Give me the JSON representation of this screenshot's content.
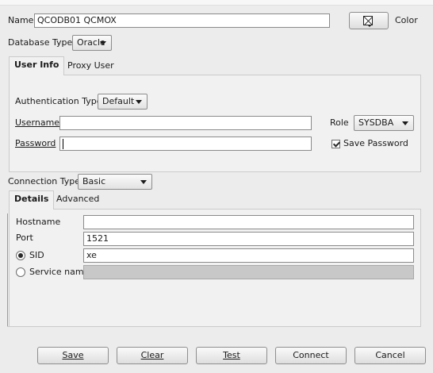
{
  "name": {
    "label": "Name",
    "value": "QCODB01 QCMOX"
  },
  "color": {
    "label": "Color"
  },
  "database_type": {
    "label": "Database Type",
    "value": "Oracle"
  },
  "top_tabs": [
    {
      "label": "User Info"
    },
    {
      "label": "Proxy User"
    }
  ],
  "auth": {
    "label": "Authentication Type",
    "value": "Default"
  },
  "username": {
    "label": "Username",
    "value": ""
  },
  "password": {
    "label": "Password",
    "value": ""
  },
  "role": {
    "label": "Role",
    "value": "SYSDBA"
  },
  "save_password": {
    "label": "Save Password",
    "checked": true
  },
  "connection_type": {
    "label": "Connection Type",
    "value": "Basic"
  },
  "conn_tabs": [
    {
      "label": "Details"
    },
    {
      "label": "Advanced"
    }
  ],
  "hostname": {
    "label": "Hostname",
    "value": ""
  },
  "port": {
    "label": "Port",
    "value": "1521"
  },
  "sid": {
    "label": "SID",
    "value": "xe",
    "selected": true
  },
  "service_name": {
    "label": "Service name",
    "value": "",
    "enabled": false
  },
  "buttons": {
    "save": "Save",
    "clear": "Clear",
    "test": "Test",
    "connect": "Connect",
    "cancel": "Cancel"
  },
  "icons": {
    "color_swatch": "no-color-swatch-icon",
    "dropdown": "chevron-down-icon"
  }
}
